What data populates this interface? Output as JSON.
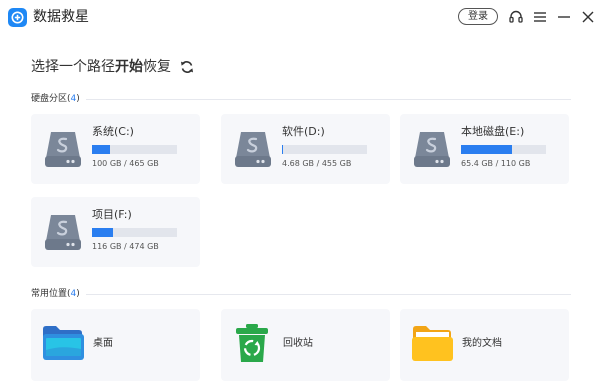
{
  "app": {
    "title": "数据救星",
    "login_label": "登录",
    "brand_color": "#1e88f5",
    "icons": [
      "headset-icon",
      "menu-icon",
      "minimize-icon",
      "close-icon"
    ]
  },
  "main": {
    "title_prefix": "选择一个路径",
    "title_strong": "开始",
    "title_suffix": "恢复",
    "refresh_icon": "refresh-icon"
  },
  "drives_section": {
    "label": "硬盘分区",
    "count_open": "(",
    "count": "4",
    "count_close": ")",
    "accent_color": "#2a7ef0",
    "items": [
      {
        "name": "系统(C:)",
        "size": "100 GB / 465 GB",
        "used_fraction": 0.215,
        "icon": "hard-drive-icon"
      },
      {
        "name": "软件(D:)",
        "size": "4.68 GB / 455 GB",
        "used_fraction": 0.012,
        "icon": "hard-drive-icon"
      },
      {
        "name": "本地磁盘(E:)",
        "size": "65.4 GB / 110 GB",
        "used_fraction": 0.595,
        "icon": "hard-drive-icon"
      },
      {
        "name": "项目(F:)",
        "size": "116 GB / 474 GB",
        "used_fraction": 0.245,
        "icon": "hard-drive-icon"
      }
    ]
  },
  "locations_section": {
    "label": "常用位置",
    "count_open": "(",
    "count": "4",
    "count_close": ")",
    "items": [
      {
        "name": "桌面",
        "icon": "desktop-folder-icon"
      },
      {
        "name": "回收站",
        "icon": "recycle-bin-icon"
      },
      {
        "name": "我的文档",
        "icon": "documents-folder-icon"
      }
    ]
  }
}
